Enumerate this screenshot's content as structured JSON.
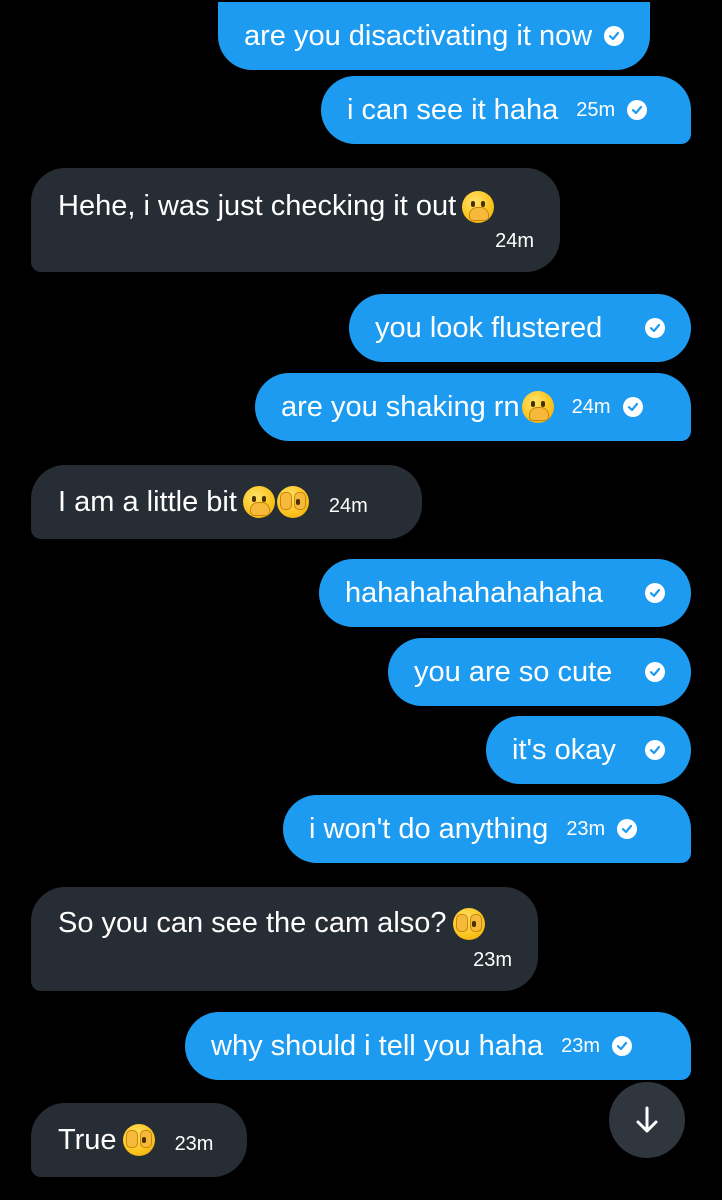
{
  "messages": [
    {
      "side": "sent",
      "text": "are you disactivating it now",
      "time": "",
      "emoji": ""
    },
    {
      "side": "sent",
      "text": "i can see it haha",
      "time": "25m",
      "emoji": ""
    },
    {
      "side": "received",
      "text": "Hehe, i was just checking it out",
      "time": "24m",
      "emoji": "hand-over-mouth"
    },
    {
      "side": "sent",
      "text": "you look flustered",
      "time": "",
      "emoji": ""
    },
    {
      "side": "sent",
      "text": "are you shaking rn",
      "time": "24m",
      "emoji": "hand-over-mouth"
    },
    {
      "side": "received",
      "text": "I am a little bit",
      "time": "24m",
      "emoji": "hand-over-mouth, peeking"
    },
    {
      "side": "sent",
      "text": "hahahahahahahaha",
      "time": "",
      "emoji": ""
    },
    {
      "side": "sent",
      "text": "you are so cute",
      "time": "",
      "emoji": ""
    },
    {
      "side": "sent",
      "text": "it's okay",
      "time": "",
      "emoji": ""
    },
    {
      "side": "sent",
      "text": "i won't do anything",
      "time": "23m",
      "emoji": ""
    },
    {
      "side": "received",
      "text": "So you can see the cam also?",
      "time": "23m",
      "emoji": "peeking"
    },
    {
      "side": "sent",
      "text": "why should i tell you haha",
      "time": "23m",
      "emoji": ""
    },
    {
      "side": "received",
      "text": "True",
      "time": "23m",
      "emoji": "peeking"
    }
  ],
  "colors": {
    "background": "#000000",
    "sent_bubble": "#1d9bf0",
    "received_bubble": "#262d34",
    "scroll_button": "#2f363d"
  },
  "icons": {
    "read_receipt": "check-circle-icon",
    "scroll_down": "arrow-down-icon"
  }
}
